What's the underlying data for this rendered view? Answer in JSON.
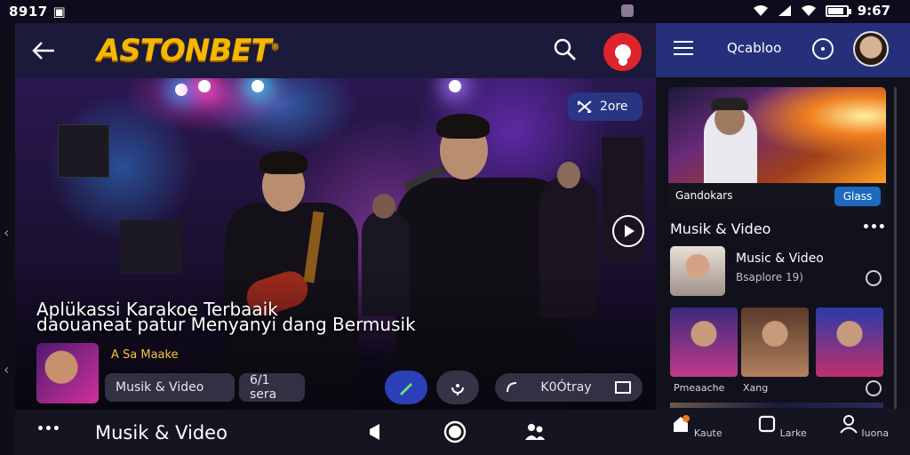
{
  "status_bar": {
    "left_text": "8917 ▣",
    "time": "9:67"
  },
  "app_bar": {
    "logo_text": "ASTONBET",
    "logo_mark": "®",
    "brand_color": "#f5b800",
    "accent_red": "#e0242c"
  },
  "hero": {
    "tag_label": "2ore",
    "title": "Aplükassi Karakoe Terbaaik",
    "subtitle": "daouaneat patur Menyanyi dang Bermusik",
    "artist_name": "A Sa Maake",
    "pills": {
      "left_label": "Musik & Video",
      "center_label": "6/1 sera",
      "right_label": "K0Ótray"
    }
  },
  "bottom_bar": {
    "title": "Musik & Video",
    "icons": [
      "more-dots-icon",
      "megaphone-icon",
      "record-icon",
      "people-icon"
    ]
  },
  "right_pane": {
    "header_title": "Qcabloo",
    "feature": {
      "label": "Gandokars",
      "button_label": "Glass"
    },
    "section_title": "Musik & Video",
    "section_more": "•••",
    "list_item": {
      "title": "Music & Video",
      "subtitle": "Bsaplore 19)"
    },
    "grid_labels": [
      "Pmeaache",
      "Xang"
    ],
    "nav": [
      {
        "label": "Kaute",
        "icon": "home-icon"
      },
      {
        "label": "Larke",
        "icon": "square-icon"
      },
      {
        "label": "Iuona",
        "icon": "profile-icon"
      }
    ]
  }
}
